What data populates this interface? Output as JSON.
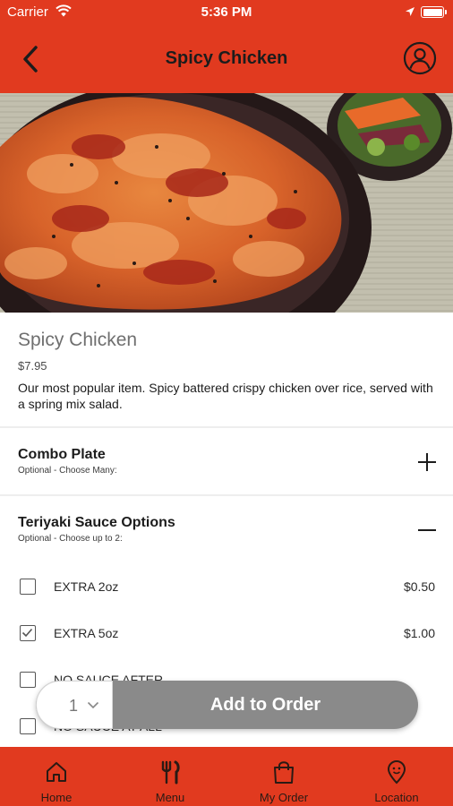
{
  "status_bar": {
    "carrier": "Carrier",
    "time": "5:36 PM"
  },
  "header": {
    "title": "Spicy Chicken"
  },
  "item": {
    "name": "Spicy Chicken",
    "price": "$7.95",
    "description": "Our most popular item. Spicy battered crispy chicken over rice, served with a spring mix salad."
  },
  "sections": [
    {
      "title": "Combo Plate",
      "subtitle": "Optional - Choose Many:",
      "expanded": false
    },
    {
      "title": "Teriyaki Sauce Options",
      "subtitle": "Optional - Choose up to 2:",
      "expanded": true
    }
  ],
  "options": [
    {
      "label": "EXTRA 2oz",
      "price": "$0.50",
      "checked": false
    },
    {
      "label": "EXTRA 5oz",
      "price": "$1.00",
      "checked": true
    },
    {
      "label": "NO SAUCE AFTER",
      "price": "",
      "checked": false
    },
    {
      "label": "NO SAUCE AT ALL",
      "price": "",
      "checked": false
    }
  ],
  "order_bar": {
    "quantity": "1",
    "add_label": "Add to Order"
  },
  "tabs": [
    {
      "label": "Home",
      "icon": "home-icon"
    },
    {
      "label": "Menu",
      "icon": "utensils-icon"
    },
    {
      "label": "My Order",
      "icon": "shopping-bag-icon"
    },
    {
      "label": "Location",
      "icon": "map-pin-icon"
    }
  ],
  "colors": {
    "brand": "#e13a1f",
    "add_button": "#8a8a8a"
  }
}
